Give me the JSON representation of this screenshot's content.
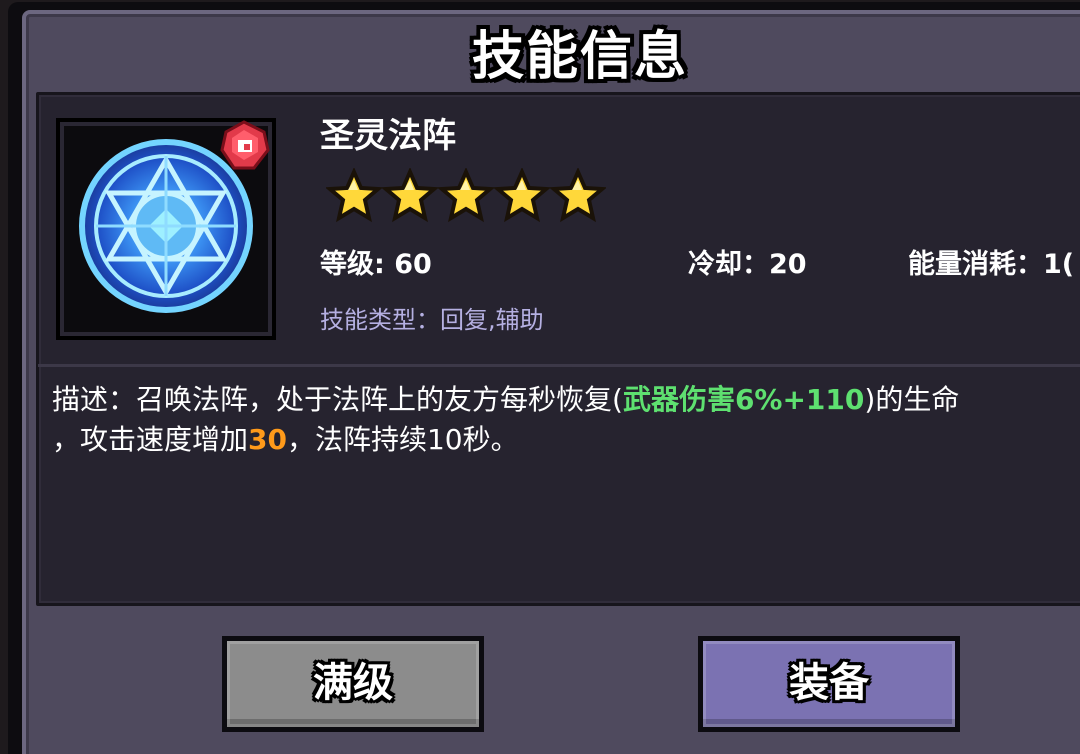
{
  "dialog": {
    "title": "技能信息"
  },
  "skill": {
    "name": "圣灵法阵",
    "stars": 5,
    "level_text": "等级: 60",
    "cooldown_text": "冷却：20",
    "energy_text": "能量消耗：1(",
    "type_text": "技能类型：回复,辅助",
    "icon": "magic-circle-icon",
    "badge_icon": "red-gem-badge-icon"
  },
  "description": {
    "line1_a": "描述：召唤法阵，处于法阵上的友方每秒恢复(",
    "line1_highlight": "武器伤害6%+110",
    "line1_b": ")的生命",
    "line2_a": "，攻击速度增加",
    "line2_highlight": "30",
    "line2_b": "，法阵持续10秒。"
  },
  "buttons": {
    "max_level": "满级",
    "equip": "装备"
  },
  "colors": {
    "panel": "#4f4a5e",
    "content_bg": "#26232f",
    "type_text": "#b5b0e2",
    "green_highlight": "#5ee070",
    "orange_highlight": "#ff9a1a",
    "button_gray": "#8c8c8c",
    "button_purple": "#7b72b2",
    "star": "#ffd83a"
  }
}
